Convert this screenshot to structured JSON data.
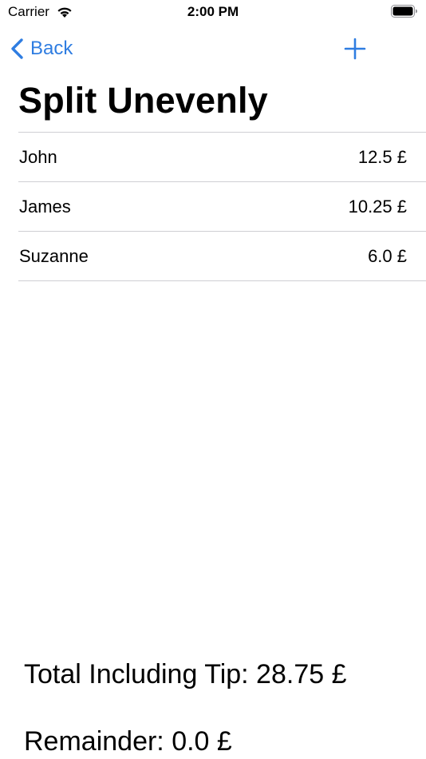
{
  "status_bar": {
    "carrier": "Carrier",
    "time": "2:00 PM"
  },
  "nav": {
    "back_label": "Back",
    "accent_color": "#2f7de1"
  },
  "title": "Split Unevenly",
  "people": [
    {
      "name": "John",
      "amount": "12.5 £"
    },
    {
      "name": "James",
      "amount": "10.25 £"
    },
    {
      "name": "Suzanne",
      "amount": "6.0 £"
    }
  ],
  "summary": {
    "total": "Total Including Tip: 28.75 £",
    "remainder": "Remainder: 0.0 £"
  }
}
